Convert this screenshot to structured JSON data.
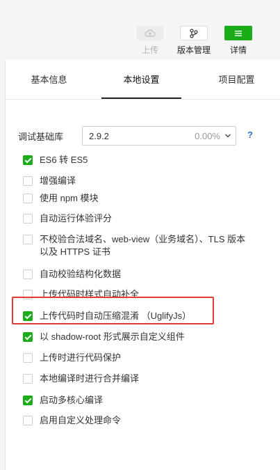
{
  "toolbar": {
    "upload_label": "上传",
    "version_label": "版本管理",
    "details_label": "详情",
    "details_icon": "menu-icon",
    "accent": "#1aad19"
  },
  "tabs": [
    {
      "label": "基本信息",
      "active": false
    },
    {
      "label": "本地设置",
      "active": true
    },
    {
      "label": "项目配置",
      "active": false
    }
  ],
  "settings": {
    "base_lib_label": "调试基础库",
    "base_lib_value": "2.9.2",
    "base_lib_usage": "0.00%",
    "help": "?",
    "options": [
      {
        "label": "ES6 转 ES5",
        "checked": true
      },
      {
        "label": "增强编译",
        "checked": false
      },
      {
        "label": "使用 npm 模块",
        "checked": false
      },
      {
        "label": "自动运行体验评分",
        "checked": false
      },
      {
        "label": "不校验合法域名、web-view（业务域名）、TLS 版本以及 HTTPS 证书",
        "checked": false
      },
      {
        "label": "自动校验结构化数据",
        "checked": false
      },
      {
        "label": "上传代码时样式自动补全",
        "checked": false
      },
      {
        "label": "上传代码时自动压缩混淆 （UglifyJs）",
        "checked": true,
        "highlighted": true
      },
      {
        "label": "以 shadow-root 形式展示自定义组件",
        "checked": true
      },
      {
        "label": "上传时进行代码保护",
        "checked": false
      },
      {
        "label": "本地编译时进行合并编译",
        "checked": false
      },
      {
        "label": "启动多核心编译",
        "checked": true
      },
      {
        "label": "启用自定义处理命令",
        "checked": false
      }
    ]
  }
}
